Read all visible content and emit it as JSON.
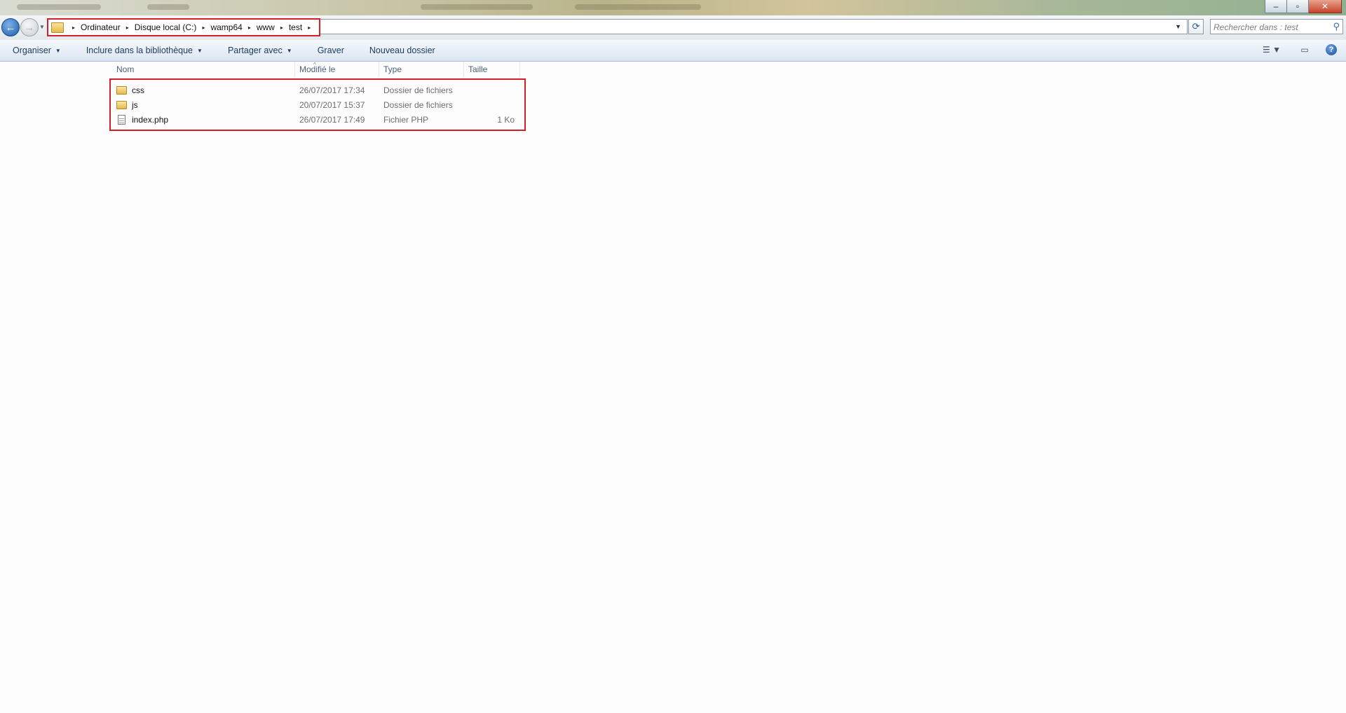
{
  "window": {
    "controls": {
      "minimize": "–",
      "maximize": "▫",
      "close": "✕"
    }
  },
  "navigation": {
    "back_icon": "←",
    "forward_icon": "→",
    "history_dropdown": "▼"
  },
  "address": {
    "separator": "▸",
    "breadcrumbs": [
      "Ordinateur",
      "Disque local (C:)",
      "wamp64",
      "www",
      "test"
    ],
    "dropdown": "▼",
    "refresh_icon": "⟳"
  },
  "search": {
    "placeholder": "Rechercher dans : test",
    "icon": "⚲"
  },
  "toolbar": {
    "items": [
      {
        "label": "Organiser",
        "caret": "▼"
      },
      {
        "label": "Inclure dans la bibliothèque",
        "caret": "▼"
      },
      {
        "label": "Partager avec",
        "caret": "▼"
      },
      {
        "label": "Graver"
      },
      {
        "label": "Nouveau dossier"
      }
    ],
    "view_icon": "☰ ▼",
    "preview_pane_icon": "▭",
    "help_icon": "?"
  },
  "file_list": {
    "sort_indicator": "^",
    "columns": [
      "Nom",
      "Modifié le",
      "Type",
      "Taille"
    ],
    "rows": [
      {
        "icon": "folder-icon",
        "name": "css",
        "modified": "26/07/2017 17:34",
        "type": "Dossier de fichiers",
        "size": ""
      },
      {
        "icon": "folder-icon",
        "name": "js",
        "modified": "20/07/2017 15:37",
        "type": "Dossier de fichiers",
        "size": ""
      },
      {
        "icon": "php-file-icon",
        "name": "index.php",
        "modified": "26/07/2017 17:49",
        "type": "Fichier PHP",
        "size": "1 Ko"
      }
    ]
  },
  "colors": {
    "highlight_box": "#d41f26",
    "toolbar_text": "#1e395b",
    "secondary_text": "#6d6d6d"
  }
}
